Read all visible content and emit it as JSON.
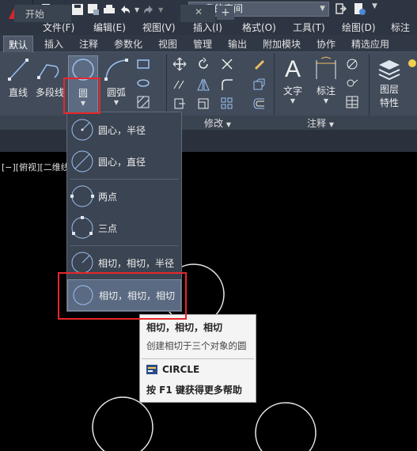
{
  "titlebar": {
    "workspace": "我的空间"
  },
  "menubar": [
    "文件(F)",
    "编辑(E)",
    "视图(V)",
    "插入(I)",
    "格式(O)",
    "工具(T)",
    "绘图(D)",
    "标注"
  ],
  "ribbon_tabs": [
    "默认",
    "插入",
    "注释",
    "参数化",
    "视图",
    "管理",
    "输出",
    "附加模块",
    "协作",
    "精选应用"
  ],
  "ribbon": {
    "draw": {
      "line": "直线",
      "polyline": "多段线",
      "circle": "圆",
      "arc": "圆弧"
    },
    "modify_label": "修改",
    "annotation": {
      "text": "文字",
      "dimension": "标注",
      "label": "注释"
    },
    "layers": {
      "label_line1": "图层",
      "label_line2": "特性"
    }
  },
  "filetabs": {
    "start": "开始",
    "close": "✕",
    "plus": "+"
  },
  "viewport_label": "[−][俯视][二维线",
  "circle_menu": [
    "圆心，半径",
    "圆心，直径",
    "两点",
    "三点",
    "相切，相切，半径",
    "相切，相切，相切"
  ],
  "tooltip": {
    "title": "相切，相切，相切",
    "description": "创建相切于三个对象的圆",
    "command": "CIRCLE",
    "help": "按 F1 键获得更多帮助"
  },
  "colors": {
    "accent_red": "#e8262b",
    "ribbon_bg": "#414b5a",
    "canvas_bg": "#000000",
    "hover": "#5a6a82"
  }
}
